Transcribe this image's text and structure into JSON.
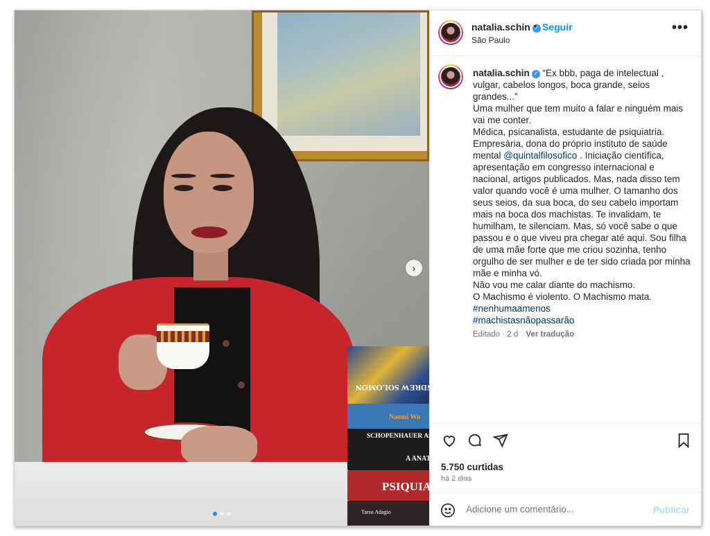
{
  "post": {
    "header": {
      "username": "natalia.schin",
      "verified": true,
      "follow_label": "Seguir",
      "separator": "•",
      "location": "São Paulo",
      "more_icon": "more-options-icon",
      "more_glyph": "•••"
    },
    "caption": {
      "username": "natalia.schin",
      "lines": [
        "“Ex bbb, paga de intelectual , vulgar, cabelos longos, boca grande, seios grandes...”",
        "Uma mulher que tem muito a falar e ninguém mais vai me conter.",
        "Médica, psicanalista, estudante de psiquiatria."
      ],
      "empresaria_pre": "Empresária, dona do próprio instituto de saúde mental",
      "mention": "@quintalfilosofico",
      "empresaria_post": ". Iniciação científica, apresentação em congresso internacional e nacional, artigos publicados. Mas, nada disso tem valor quando você é uma mulher. O tamanho dos seus seios, da sua boca, do seu cabelo importam mais na boca dos machistas. Te invalidam, te humilham, te silenciam. Mas, só você sabe o que passou e o que viveu pra chegar até aqui. Sou filha de uma mãe forte que me criou sozinha, tenho orgulho de ser mulher e de ter sido criada por minha mãe e minha vó.",
      "closing_lines": [
        "Não vou me calar diante do machismo.",
        "O Machismo é violento. O Machismo mata."
      ],
      "hashtags": [
        "#nenhumaamenos",
        "#machistasnãopassarão"
      ]
    },
    "meta": {
      "edited": "Editado · 2 d",
      "translate": "Ver tradução"
    },
    "likes": "5.750 curtidas",
    "timestamp": "há 2 dias",
    "comment": {
      "placeholder": "Adicione um comentário...",
      "publish_label": "Publicar"
    },
    "carousel": {
      "current_slide": 1,
      "total_slides": 3,
      "next_glyph": "›"
    },
    "photo_books": [
      "ANDREW SOLOMON",
      "Naomi Wo",
      "SCHOPENHAUER Aforis",
      "A ANAT",
      "PSIQUIA",
      "Tarso Adagio"
    ],
    "colors": {
      "accent": "#0095f6",
      "link": "#00376b",
      "verified": "#3897f0",
      "publish_disabled": "#b2dffc"
    }
  }
}
